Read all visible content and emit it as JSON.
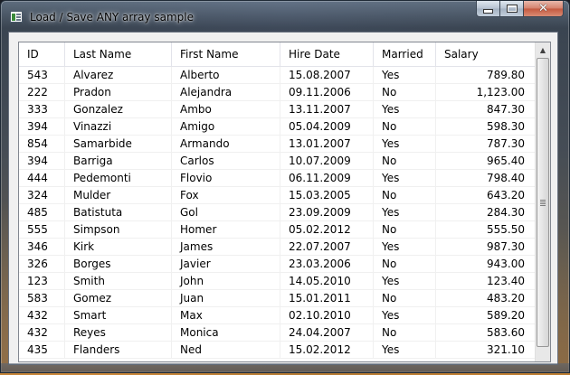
{
  "window": {
    "title": "Load / Save ANY array sample",
    "icon": "app-grid-icon",
    "controls": [
      "minimize-icon",
      "maximize-icon",
      "close-icon"
    ],
    "close_glyph": "✕"
  },
  "grid": {
    "columns": [
      "ID",
      "Last Name",
      "First Name",
      "Hire Date",
      "Married",
      "Salary"
    ],
    "rows": [
      [
        "543",
        "Alvarez",
        "Alberto",
        "15.08.2007",
        "Yes",
        "789.80"
      ],
      [
        "222",
        "Pradon",
        "Alejandra",
        "09.11.2006",
        "No",
        "1,123.00"
      ],
      [
        "333",
        "Gonzalez",
        "Ambo",
        "13.11.2007",
        "Yes",
        "847.30"
      ],
      [
        "394",
        "Vinazzi",
        "Amigo",
        "05.04.2009",
        "No",
        "598.30"
      ],
      [
        "854",
        "Samarbide",
        "Armando",
        "13.01.2007",
        "Yes",
        "787.30"
      ],
      [
        "394",
        "Barriga",
        "Carlos",
        "10.07.2009",
        "No",
        "965.40"
      ],
      [
        "444",
        "Pedemonti",
        "Flovio",
        "06.11.2009",
        "Yes",
        "798.40"
      ],
      [
        "324",
        "Mulder",
        "Fox",
        "15.03.2005",
        "No",
        "643.20"
      ],
      [
        "485",
        "Batistuta",
        "Gol",
        "23.09.2009",
        "Yes",
        "284.30"
      ],
      [
        "555",
        "Simpson",
        "Homer",
        "05.02.2012",
        "No",
        "555.50"
      ],
      [
        "346",
        "Kirk",
        "James",
        "22.07.2007",
        "Yes",
        "987.30"
      ],
      [
        "326",
        "Borges",
        "Javier",
        "23.03.2006",
        "No",
        "943.00"
      ],
      [
        "123",
        "Smith",
        "John",
        "14.05.2010",
        "Yes",
        "123.40"
      ],
      [
        "583",
        "Gomez",
        "Juan",
        "15.01.2011",
        "No",
        "483.20"
      ],
      [
        "432",
        "Smart",
        "Max",
        "02.10.2010",
        "Yes",
        "589.20"
      ],
      [
        "432",
        "Reyes",
        "Monica",
        "24.04.2007",
        "No",
        "583.60"
      ],
      [
        "435",
        "Flanders",
        "Ned",
        "15.02.2012",
        "Yes",
        "321.10"
      ]
    ]
  },
  "scrollbar": {
    "up_glyph": "▲",
    "icons": [
      "scroll-up-arrow-icon",
      "scroll-thumb-grip-icon"
    ]
  }
}
